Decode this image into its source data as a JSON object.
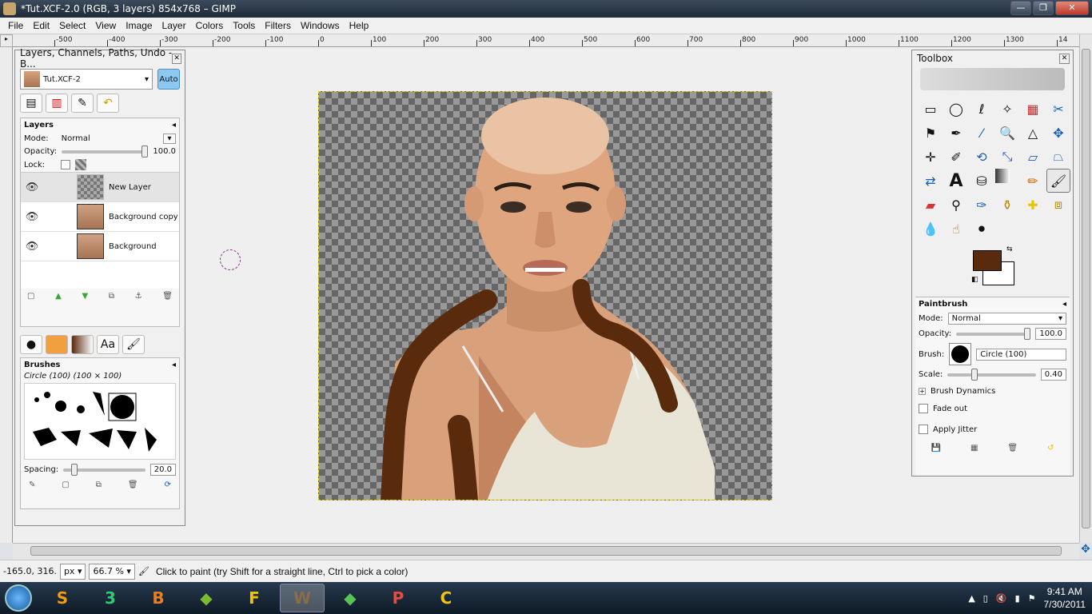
{
  "window": {
    "title": "*Tut.XCF-2.0 (RGB, 3 layers) 854x768 – GIMP",
    "minimize": "—",
    "maximize": "❐",
    "close": "✕"
  },
  "menu": [
    "File",
    "Edit",
    "Select",
    "View",
    "Image",
    "Layer",
    "Colors",
    "Tools",
    "Filters",
    "Windows",
    "Help"
  ],
  "ruler": {
    "labels": [
      "-500",
      "-400",
      "-300",
      "-200",
      "-100",
      "0",
      "100",
      "200",
      "300",
      "400",
      "500",
      "600",
      "700",
      "800",
      "900",
      "1000",
      "1100",
      "1200",
      "1300",
      "14"
    ]
  },
  "layers_dock": {
    "title": "Layers, Channels, Paths, Undo - B...",
    "image_select": "Tut.XCF-2",
    "auto_label": "Auto",
    "layers_header": "Layers",
    "mode_label": "Mode:",
    "mode_value": "Normal",
    "opacity_label": "Opacity:",
    "opacity_value": "100.0",
    "lock_label": "Lock:",
    "layers": [
      {
        "name": "New Layer"
      },
      {
        "name": "Background copy"
      },
      {
        "name": "Background"
      }
    ],
    "brushes_header": "Brushes",
    "brush_info": "Circle (100) (100 × 100)",
    "spacing_label": "Spacing:",
    "spacing_value": "20.0",
    "text_tab": "Aa"
  },
  "toolbox": {
    "title": "Toolbox",
    "tool_options_title": "Paintbrush",
    "mode_label": "Mode:",
    "mode_value": "Normal",
    "opacity_label": "Opacity:",
    "opacity_value": "100.0",
    "brush_label": "Brush:",
    "brush_value": "Circle (100)",
    "scale_label": "Scale:",
    "scale_value": "0.40",
    "dynamics_label": "Brush Dynamics",
    "fade_label": "Fade out",
    "jitter_label": "Apply Jitter",
    "fg_color": "#5a2a0c",
    "bg_color": "#ffffff"
  },
  "status": {
    "coords": "-165.0, 316.",
    "unit": "px",
    "zoom": "66.7 %",
    "message": "Click to paint (try Shift for a straight line, Ctrl to pick a color)"
  },
  "taskbar": {
    "items": [
      "S",
      "3",
      "B",
      "◆",
      "F",
      "W",
      "◆",
      "P",
      "C"
    ],
    "time": "9:41 AM",
    "date": "7/30/2011"
  }
}
